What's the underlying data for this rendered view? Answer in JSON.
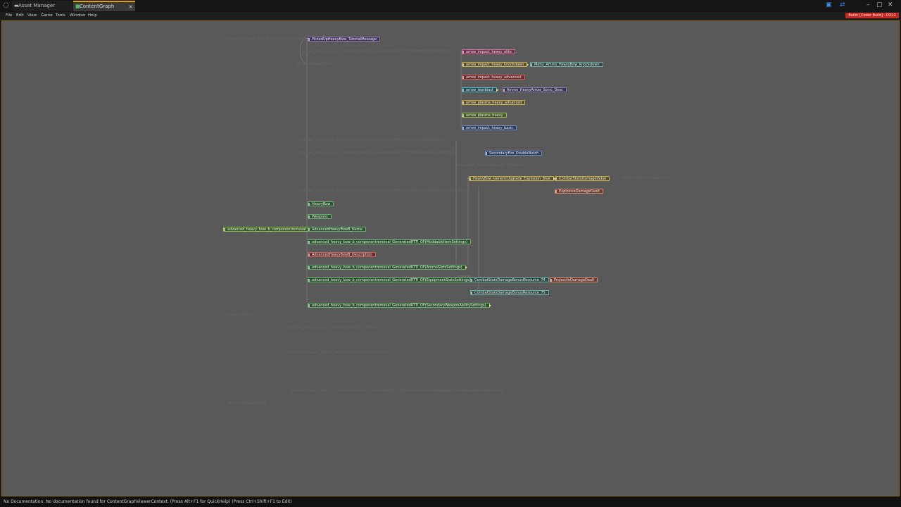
{
  "window": {
    "tabs": [
      {
        "label": "Asset Manager"
      },
      {
        "label": "ContentGraph",
        "close": "×"
      }
    ],
    "controls": [
      "▣",
      "⇄",
      "–",
      "▢",
      "✕"
    ]
  },
  "menubar": {
    "items": [
      "File",
      "Edit",
      "View",
      "Game",
      "Tools",
      "Window",
      "Help"
    ],
    "build_badge": "Build: [Coder Build] - DX12"
  },
  "colors": {
    "accent": "#e0a000",
    "badge": "#c6281f",
    "canvas": "#595959"
  },
  "graph": {
    "nodes": [
      {
        "label": "PickedUpHeavyBow_TutorialMessage",
        "color": "purple"
      },
      {
        "label": "arrow_impact_heavy_elite",
        "color": "pink"
      },
      {
        "label": "arrow_impact_heavy_knockdown",
        "color": "yellow"
      },
      {
        "label": "Menu_Ammo_HeavyBow_Knockdown",
        "color": "teal"
      },
      {
        "label": "arrow_impact_heavy_advanced",
        "color": "red"
      },
      {
        "label": "arrow_tearblast",
        "color": "cyan"
      },
      {
        "label": "Ammo_HeavyArrow_Sonic_Desc",
        "color": "purple"
      },
      {
        "label": "arrow_plasma_heavy_advanced",
        "color": "yellow"
      },
      {
        "label": "arrow_plasma_heavy",
        "color": "lime"
      },
      {
        "label": "arrow_impact_heavy_basic",
        "color": "blue"
      },
      {
        "label": "SecondaryFire_DoubleNotch",
        "color": "blue"
      },
      {
        "label": "HeavyBow_GenericUpgrade_Explosion_Blue",
        "color": "yellow"
      },
      {
        "label": "CombatStatsDamageValue",
        "color": "yellow"
      },
      {
        "label": "ExplosiveDamageDealt",
        "color": "salmon"
      },
      {
        "label": "HeavyBow",
        "color": "green"
      },
      {
        "label": "Weapons",
        "color": "green"
      },
      {
        "label": "advanced_heavy_bow_b_componentremoval",
        "color": "green"
      },
      {
        "label": "AdvancedHeavyBowB_Name",
        "color": "green"
      },
      {
        "label": "advanced_heavy_bow_b_componentremoval_GeneratedRTTI_OF(ModdableItemSettings)",
        "color": "green"
      },
      {
        "label": "AdvancedHeavyBowB_Description",
        "color": "red"
      },
      {
        "label": "advanced_heavy_bow_b_componentremoval_GeneratedRTTI_OF(AmmoSlotsSettings)",
        "color": "green"
      },
      {
        "label": "advanced_heavy_bow_b_componentremoval_GeneratedRTTI_OF(EquipmentStatsSettings)",
        "color": "green"
      },
      {
        "label": "CombatStatsDamageBonusResource_74",
        "color": "teal"
      },
      {
        "label": "ProjectileDamageDealt",
        "color": "salmon"
      },
      {
        "label": "CombatStatsDamageBonusResource_75",
        "color": "teal"
      },
      {
        "label": "advanced_heavy_bow_b_componentremoval_GeneratedRTTI_OF(SecondaryWeaponAbilitySettings)",
        "color": "green"
      }
    ],
    "faded": [
      "advanced_heavy_bow_b_componentremoval",
      "advanced_heavy_bow_b_componentremoval_GeneratedRTTI_OF(ModdableItemSettings)",
      "PickedUpHeavyBow",
      "advanced_heavy_bow_b_componentremoval_GeneratedRTTI_OF(AmmoSlotsSettings)",
      "advanced_heavy_bow_b_componentremoval_GeneratedRTTI_OF(EquipmentStatsSettings)",
      "advanced_heavy_bow_b_componentremoval_GeneratedRTTI_OF(SecondaryWeaponAbilitySettings)",
      "HeavyBow_GenericUpgrade_Explosion",
      "CombatStatsDamageValue",
      "WeaponsItem",
      "advanced_heavy_bow_b_componentremoval_Name",
      "advanced_heavy_bow_b_componentremoval_Description",
      "AdvancedHeavyBowB",
      "advanced_heavy_bow_b_componentremoval_GeneratedRTTI_OF(EquipmentStatsSettings)",
      "CombatStatsDamageBonusResource"
    ]
  },
  "status": {
    "text": "No Documentation. No documentation found for ContentGraphViewerContext. (Press Alt+F1 for QuickHelp) (Press Ctrl+Shift+F1 to Edit)"
  }
}
